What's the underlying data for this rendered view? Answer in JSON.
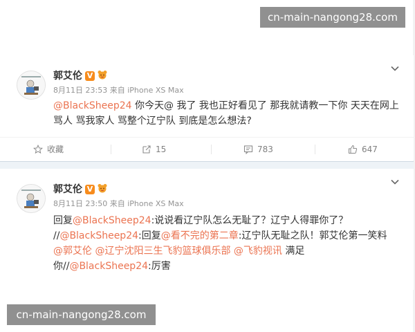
{
  "watermarks": {
    "top": "cn-main-nangong28.com",
    "bottom": "cn-main-nangong28.com"
  },
  "posts": [
    {
      "author": "郭艾伦",
      "verified_badge": "V",
      "date": "8月11日 23:53",
      "source_prefix": "来自",
      "device": "iPhone XS Max",
      "text_mention_1": "@BlackSheep24",
      "text_rest": " 你今天@ 我了 我也正好看见了 那我就请教一下你 天天在网上骂人 骂我家人 骂整个辽宁队 到底是怎么想法?",
      "actions": {
        "favorite_label": "收藏",
        "forward_count": "15",
        "comment_count": "783",
        "like_count": "647"
      }
    },
    {
      "author": "郭艾伦",
      "verified_badge": "V",
      "date": "8月11日 23:50",
      "source_prefix": "来自",
      "device": "iPhone XS Max",
      "segments": {
        "s1": "回复",
        "m1": "@BlackSheep24",
        "s2": ":说说看辽宁队怎么无耻了？辽宁人得罪你了？ //",
        "m2": "@BlackSheep24",
        "s3": ":回复",
        "m3": "@看不完的第二章",
        "s4": ":辽宁队无耻之队！郭艾伦第一笑料 ",
        "m4": "@郭艾伦",
        "s5": " ",
        "m5": "@辽宁沈阳三生飞豹篮球俱乐部",
        "s6": " ",
        "m6": "@飞豹视讯",
        "s7": " 满足你//",
        "m7": "@BlackSheep24",
        "s8": ":厉害"
      }
    }
  ],
  "colors": {
    "mention": "#eb7350",
    "meta": "#939393",
    "separator": "#eef3f7",
    "verified": "#f78c1d"
  }
}
